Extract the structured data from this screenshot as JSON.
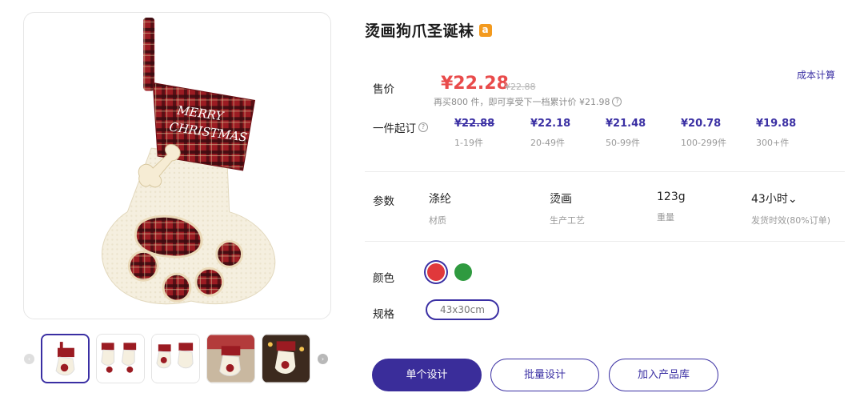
{
  "product": {
    "title": "烫画狗爪圣诞袜",
    "brand_badge": "a",
    "cost_link": "成本计算"
  },
  "price": {
    "label": "售价",
    "main": "¥22.28",
    "original": "¥22.88",
    "note": "再买800 件，即可享受下一档累计价 ¥21.98"
  },
  "tiers": {
    "label": "一件起订",
    "items": [
      {
        "price": "¥22.88",
        "qty": "1-19件",
        "struck": true
      },
      {
        "price": "¥22.18",
        "qty": "20-49件",
        "struck": false
      },
      {
        "price": "¥21.48",
        "qty": "50-99件",
        "struck": false
      },
      {
        "price": "¥20.78",
        "qty": "100-299件",
        "struck": false
      },
      {
        "price": "¥19.88",
        "qty": "300+件",
        "struck": false
      }
    ]
  },
  "params": {
    "label": "参数",
    "items": [
      {
        "value": "涤纶",
        "label": "材质"
      },
      {
        "value": "烫画",
        "label": "生产工艺"
      },
      {
        "value": "123g",
        "label": "重量"
      },
      {
        "value": "43小时⌄",
        "label": "发货时效(80%订单)"
      }
    ]
  },
  "color": {
    "label": "颜色",
    "options": [
      {
        "name": "red",
        "hex": "#e0383b",
        "selected": true
      },
      {
        "name": "green",
        "hex": "#2f9a3f",
        "selected": false
      }
    ]
  },
  "spec": {
    "label": "规格",
    "selected": "43x30cm"
  },
  "actions": {
    "single_design": "单个设计",
    "batch_design": "批量设计",
    "add_to_library": "加入产品库"
  },
  "stocking_text": {
    "line1": "MERRY",
    "line2": "CHRISTMAS"
  },
  "theme": {
    "accent": "#3a2fa3",
    "price_red": "#e94b4b"
  }
}
